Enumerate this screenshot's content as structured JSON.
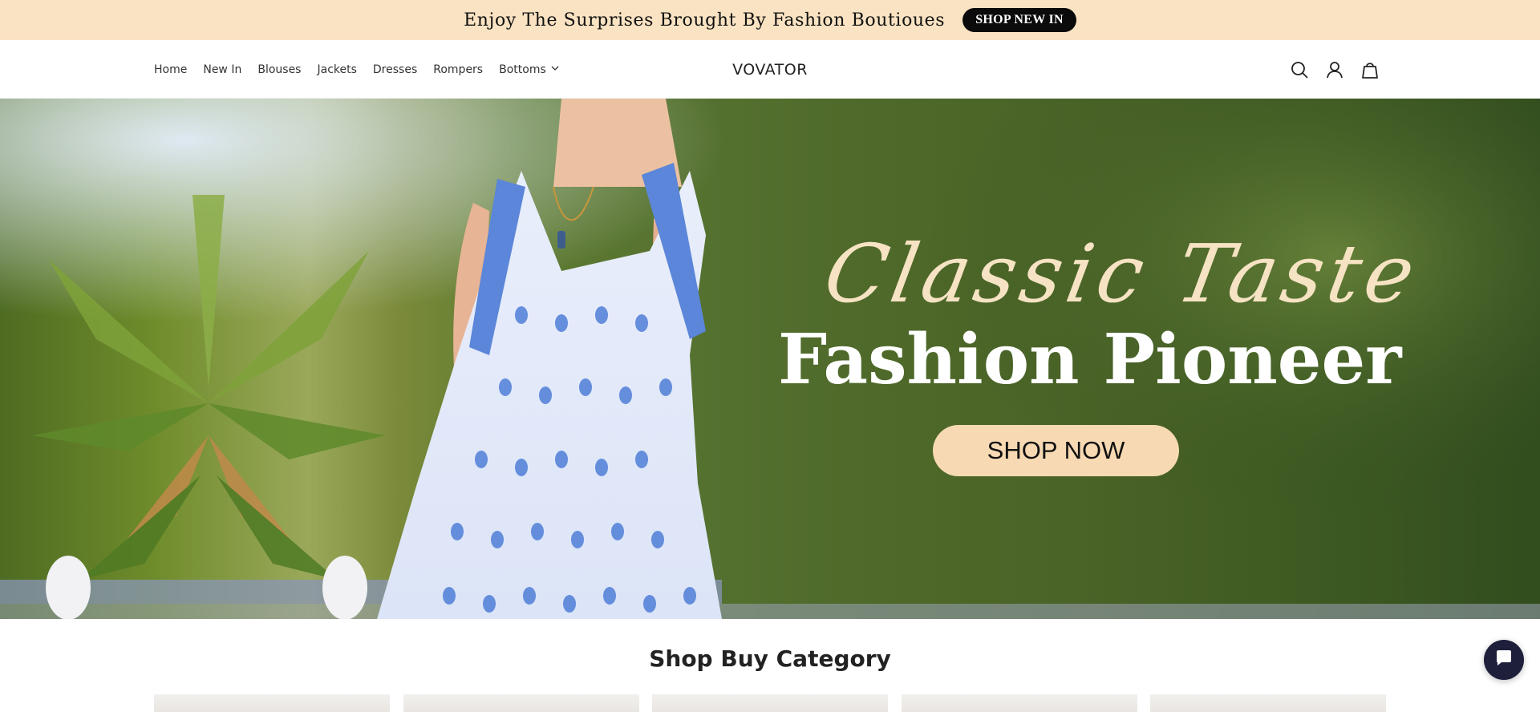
{
  "announcement": {
    "text": "Enjoy The Surprises Brought By Fashion Boutioues",
    "button_label": "SHOP NEW IN",
    "background": "#fae3c2"
  },
  "header": {
    "nav": [
      {
        "label": "Home"
      },
      {
        "label": "New In"
      },
      {
        "label": "Blouses"
      },
      {
        "label": "Jackets"
      },
      {
        "label": "Dresses"
      },
      {
        "label": "Rompers"
      },
      {
        "label": "Bottoms"
      }
    ],
    "logo": "VOVATOR",
    "icons": [
      "search-icon",
      "account-icon",
      "cart-icon"
    ]
  },
  "hero": {
    "script_text": "Classic Taste",
    "headline": "Fashion Pioneer",
    "cta_label": "SHOP NOW",
    "cta_color": "#f7d9b3"
  },
  "category": {
    "title": "Shop Buy Category"
  },
  "chat": {
    "icon": "chat-icon",
    "color": "#1e1f3b"
  }
}
